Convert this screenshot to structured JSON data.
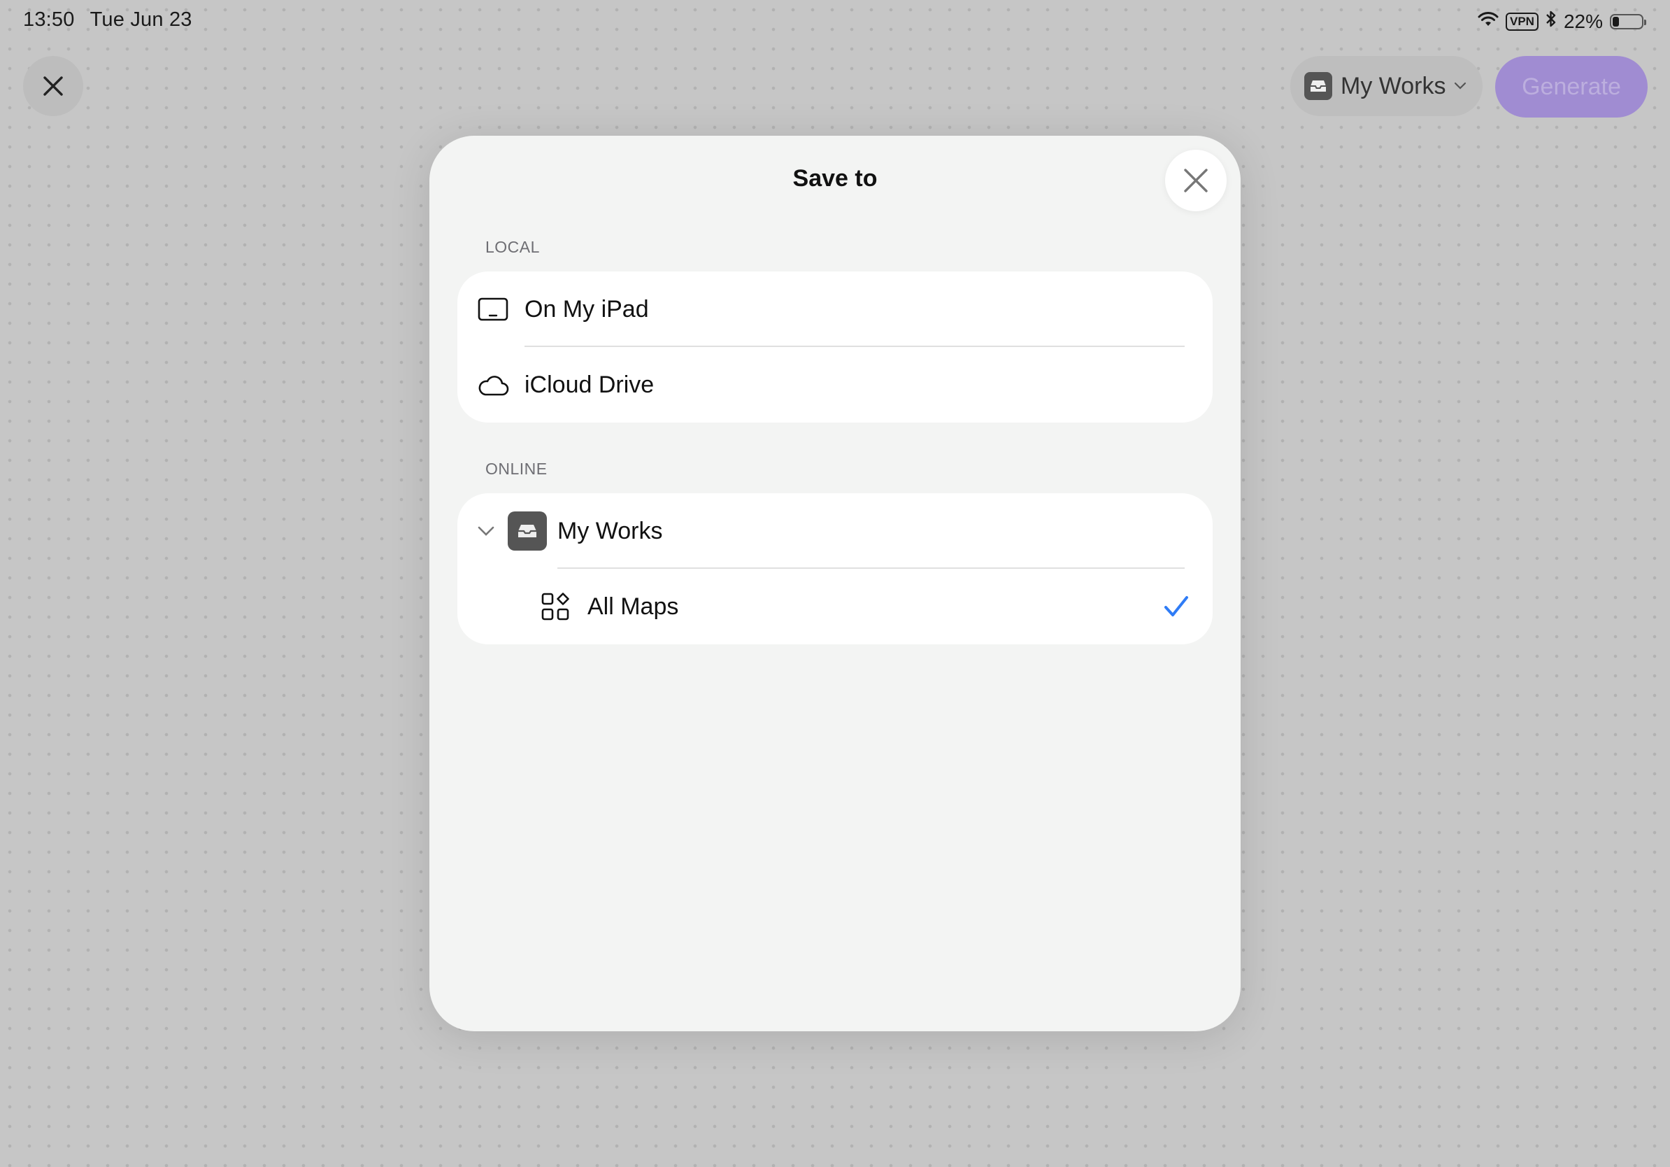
{
  "status_bar": {
    "time": "13:50",
    "date": "Tue Jun 23",
    "vpn": "VPN",
    "battery_text": "22%",
    "battery_level": 0.22
  },
  "toolbar": {
    "workspace_label": "My Works",
    "generate_label": "Generate"
  },
  "dialog": {
    "title": "Save to",
    "sections": {
      "local": {
        "header": "LOCAL",
        "items": [
          {
            "label": "On My iPad",
            "icon": "ipad-icon"
          },
          {
            "label": "iCloud Drive",
            "icon": "cloud-icon"
          }
        ]
      },
      "online": {
        "header": "ONLINE",
        "workspace": {
          "label": "My Works",
          "icon": "drawer-icon",
          "expanded": true
        },
        "folders": [
          {
            "label": "All Maps",
            "icon": "grid-icon",
            "selected": true
          }
        ]
      }
    }
  },
  "colors": {
    "accent": "#2f7cf6",
    "generate_bg": "#a08cd2",
    "modal_bg": "#f3f4f3"
  }
}
